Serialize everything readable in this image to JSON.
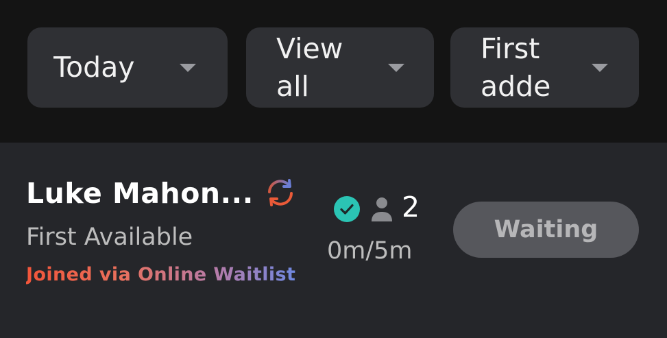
{
  "filters": {
    "date": {
      "label": "Today"
    },
    "view": {
      "label": "View all"
    },
    "order": {
      "label": "First adde"
    }
  },
  "entry": {
    "name": "Luke Mahon...",
    "service": "First Available",
    "source": "Joined via Online Waitlist",
    "party_size": "2",
    "wait_time": "0m/5m",
    "status": "Waiting"
  },
  "colors": {
    "check": "#2bc4b4",
    "status_button": "#56575c",
    "source_gradient_start": "#f2553a",
    "source_gradient_end": "#6f88e0"
  },
  "icons": {
    "sync": "sync-icon",
    "check": "check-circle-icon",
    "person": "person-icon",
    "caret": "chevron-down-icon"
  }
}
